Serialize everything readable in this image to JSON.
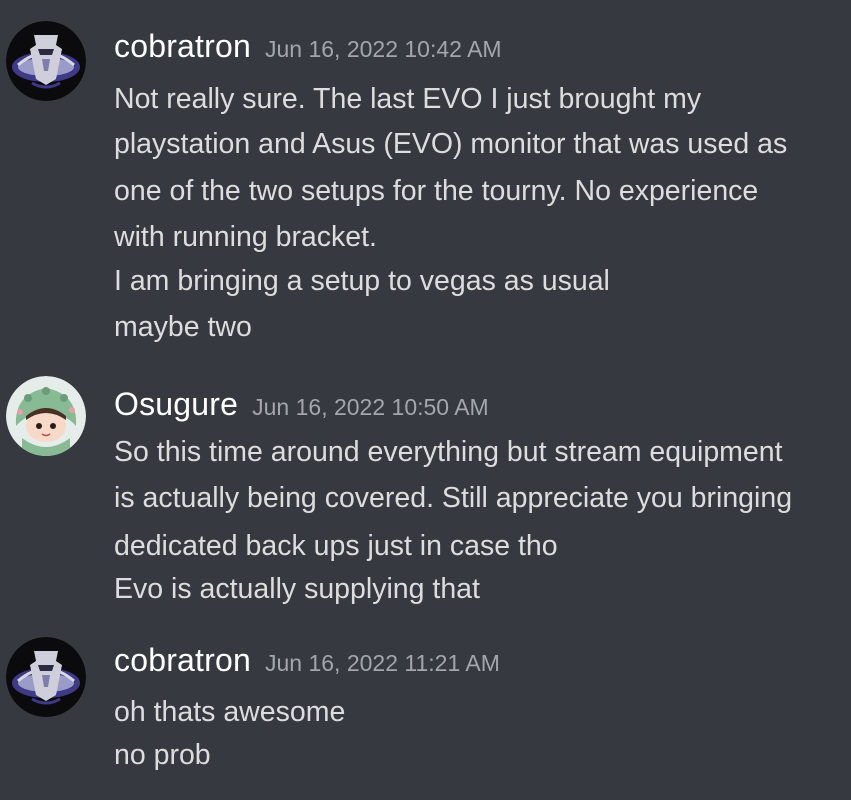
{
  "messages": [
    {
      "username": "cobratron",
      "timestamp": "Jun 16, 2022 10:42 AM",
      "avatar_icon": "decepticon-cobra-avatar",
      "lines": [
        "Not really sure. The last EVO I just brought my",
        "playstation and Asus (EVO) monitor that was used as",
        "one of the two setups for the tourny. No experience",
        "with running bracket.",
        "I am bringing a setup to vegas as usual",
        "maybe two"
      ]
    },
    {
      "username": "Osugure",
      "timestamp": "Jun 16, 2022 10:50 AM",
      "avatar_icon": "dino-hoodie-girl-avatar",
      "lines": [
        "So this time around everything but stream equipment",
        "is actually being covered. Still appreciate you bringing",
        "dedicated back ups just in case tho",
        "Evo is actually supplying that"
      ]
    },
    {
      "username": "cobratron",
      "timestamp": "Jun 16, 2022 11:21 AM",
      "avatar_icon": "decepticon-cobra-avatar",
      "lines": [
        "oh thats awesome",
        "no prob"
      ]
    }
  ],
  "colors": {
    "background": "#36393f",
    "username": "#ffffff",
    "timestamp": "#a3a6aa",
    "message_text": "#dcddde"
  }
}
